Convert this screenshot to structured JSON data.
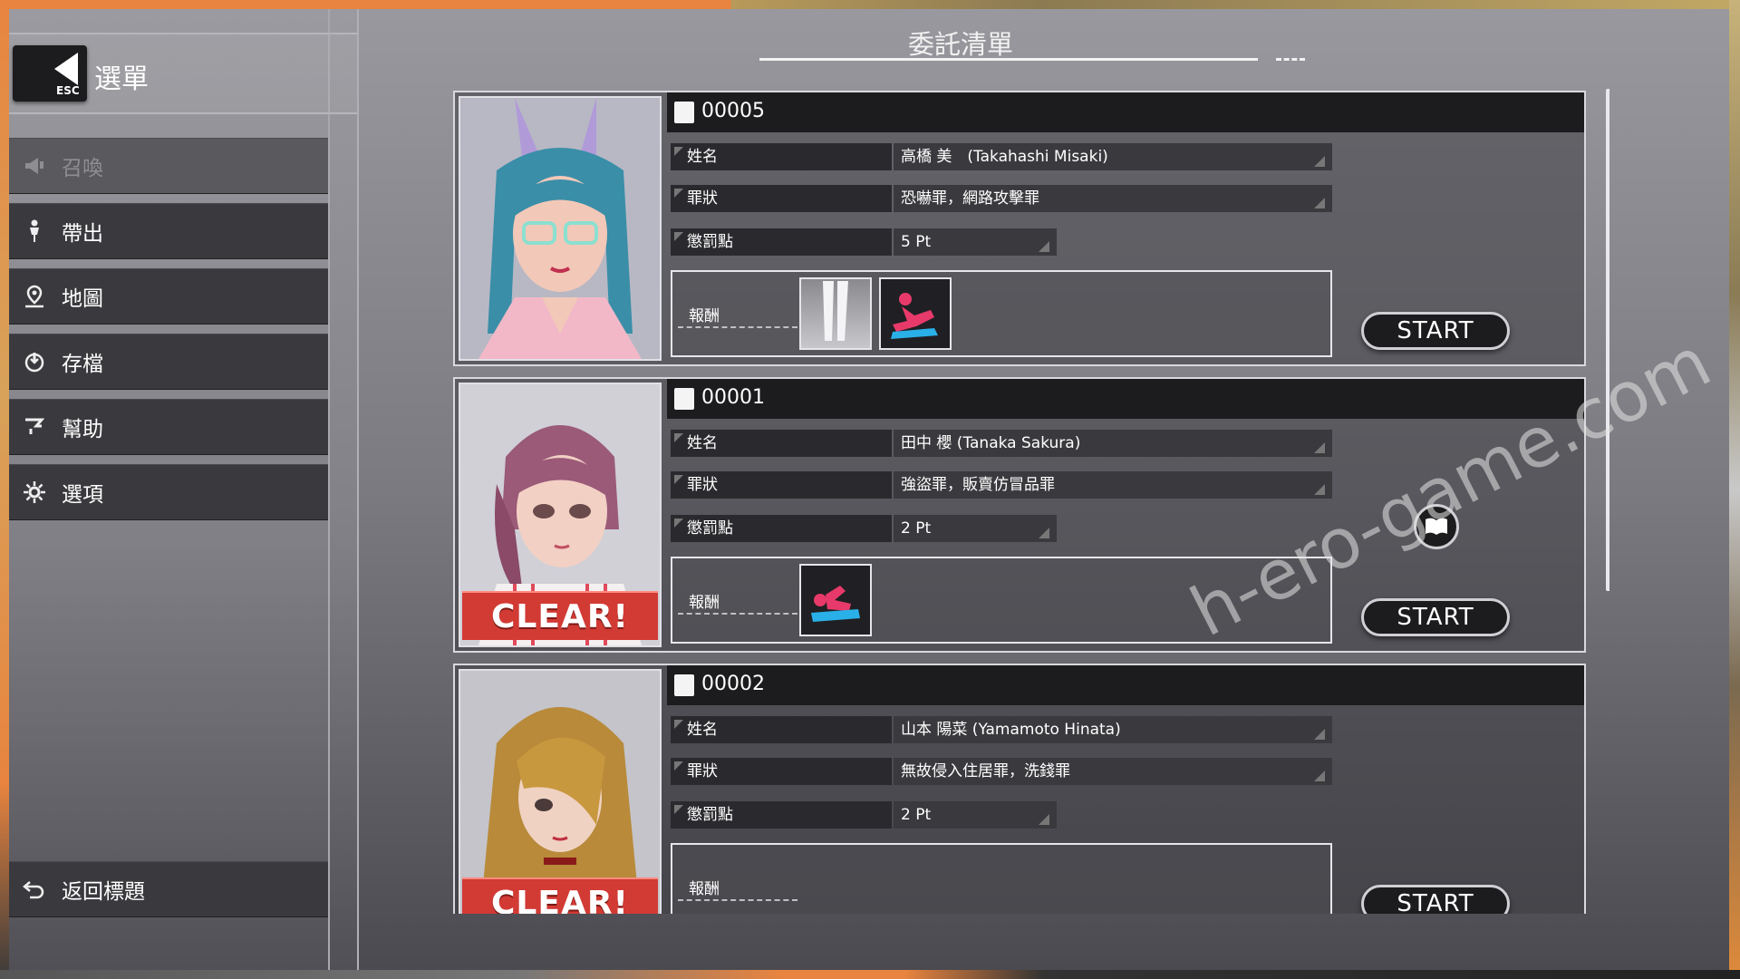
{
  "sidebar": {
    "back_key": "ESC",
    "menu_title": "選單",
    "items": [
      {
        "label": "召喚",
        "icon": "megaphone-icon",
        "disabled": true
      },
      {
        "label": "帶出",
        "icon": "person-icon",
        "disabled": false
      },
      {
        "label": "地圖",
        "icon": "map-pin-icon",
        "disabled": false
      },
      {
        "label": "存檔",
        "icon": "save-icon",
        "disabled": false
      },
      {
        "label": "幫助",
        "icon": "help-icon",
        "disabled": false
      },
      {
        "label": "選項",
        "icon": "gear-icon",
        "disabled": false
      }
    ],
    "return_label": "返回標題"
  },
  "page": {
    "title": "委託清單"
  },
  "field_labels": {
    "name": "姓名",
    "crime": "罪狀",
    "penalty": "懲罰點",
    "reward": "報酬"
  },
  "cases": [
    {
      "id": "00005",
      "name": "高橋 美　(Takahashi Misaki)",
      "crime": "恐嚇罪，網路攻擊罪",
      "penalty": "5 Pt",
      "clear": false,
      "rewards": [
        "stockings-reward-icon",
        "pose-reward-icon"
      ],
      "start_label": "START",
      "has_book": false
    },
    {
      "id": "00001",
      "name": "田中 櫻 (Tanaka Sakura)",
      "crime": "強盜罪，販賣仿冒品罪",
      "penalty": "2 Pt",
      "clear": true,
      "clear_label": "CLEAR!",
      "rewards": [
        "pose-reward-icon"
      ],
      "start_label": "START",
      "has_book": true
    },
    {
      "id": "00002",
      "name": "山本 陽菜 (Yamamoto Hinata)",
      "crime": "無故侵入住居罪，洗錢罪",
      "penalty": "2 Pt",
      "clear": true,
      "clear_label": "CLEAR!",
      "rewards": [],
      "start_label": "START",
      "has_book": false
    }
  ],
  "watermark": "h-ero-game.com",
  "colors": {
    "panel_dark": "#1c1c1e",
    "clear_red": "#d23a34",
    "accent_orange": "#e8843f"
  }
}
